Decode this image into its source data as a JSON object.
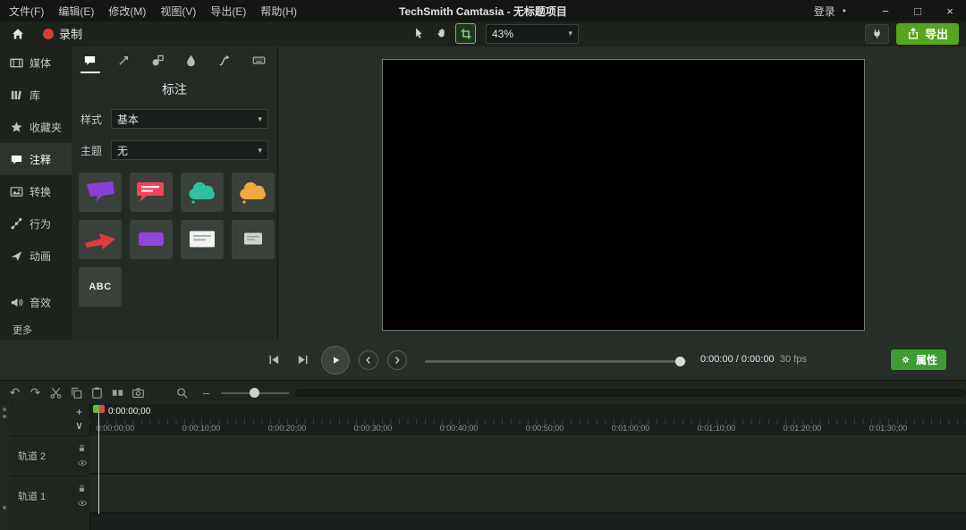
{
  "glyphs": {
    "caret_down": "▾",
    "plus": "+",
    "minus": "−",
    "chevron_down": "∨",
    "undo": "↶",
    "redo": "↷",
    "dot": "•",
    "minimize": "−",
    "maximize": "□",
    "close": "×"
  },
  "titlebar": {
    "menus": [
      "文件(F)",
      "编辑(E)",
      "修改(M)",
      "视图(V)",
      "导出(E)",
      "帮助(H)"
    ],
    "title": "TechSmith Camtasia - 无标题项目",
    "signin_label": "登录"
  },
  "toolbar": {
    "record_label": "录制",
    "zoom_value": "43%",
    "export_label": "导出"
  },
  "sidebar": {
    "items": [
      {
        "label": "媒体"
      },
      {
        "label": "库"
      },
      {
        "label": "收藏夹"
      },
      {
        "label": "注释"
      },
      {
        "label": "转换"
      },
      {
        "label": "行为"
      },
      {
        "label": "动画"
      },
      {
        "label": "音效"
      },
      {
        "label": "更多"
      }
    ]
  },
  "annotations": {
    "title": "标注",
    "style_label": "样式",
    "style_value": "基本",
    "theme_label": "主题",
    "theme_value": "无",
    "abc_label": "ABC",
    "colors": {
      "purple": "#8a3fd6",
      "red": "#ef4460",
      "teal": "#2fc29e",
      "orange": "#f2a93c",
      "arrow_red": "#e23b3b",
      "violet": "#9046d8",
      "white": "#f2f2f2",
      "light": "#ececec"
    }
  },
  "playback": {
    "time_display": "0:00:00 / 0:00:00",
    "fps_label": "30 fps",
    "properties_label": "属性"
  },
  "timeline": {
    "playhead_time": "0:00:00;00",
    "ruler_labels": [
      "0:00:00;00",
      "0:00:10;00",
      "0:00:20;00",
      "0:00:30;00",
      "0:00:40;00",
      "0:00:50;00",
      "0:01:00;00",
      "0:01:10;00",
      "0:01:20;00",
      "0:01:30;00"
    ],
    "tracks": [
      {
        "name": "轨道 2"
      },
      {
        "name": "轨道 1"
      }
    ]
  },
  "colors": {
    "record_red": "#d93a3a",
    "accent_green": "#58a41e",
    "properties_green": "#3f9b35",
    "crop_green": "#6fc24a",
    "playhead_green": "#63b94d",
    "playhead_red": "#d84a4a"
  }
}
